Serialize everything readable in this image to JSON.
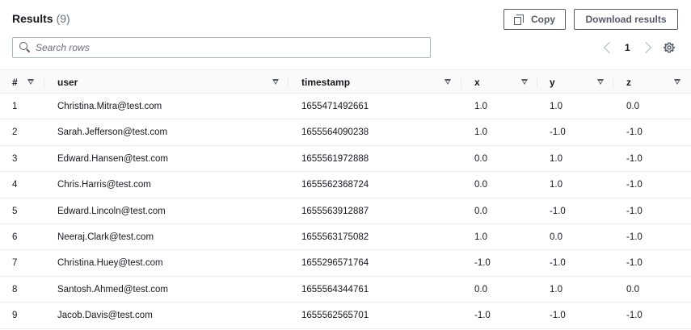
{
  "header": {
    "title": "Results",
    "count": "(9)"
  },
  "buttons": {
    "copy": "Copy",
    "download": "Download results"
  },
  "search": {
    "placeholder": "Search rows"
  },
  "pagination": {
    "current_page": "1"
  },
  "table": {
    "columns": [
      "#",
      "user",
      "timestamp",
      "x",
      "y",
      "z"
    ],
    "rows": [
      [
        "1",
        "Christina.Mitra@test.com",
        "1655471492661",
        "1.0",
        "1.0",
        "0.0"
      ],
      [
        "2",
        "Sarah.Jefferson@test.com",
        "1655564090238",
        "1.0",
        "-1.0",
        "-1.0"
      ],
      [
        "3",
        "Edward.Hansen@test.com",
        "1655561972888",
        "0.0",
        "1.0",
        "-1.0"
      ],
      [
        "4",
        "Chris.Harris@test.com",
        "1655562368724",
        "0.0",
        "1.0",
        "-1.0"
      ],
      [
        "5",
        "Edward.Lincoln@test.com",
        "1655563912887",
        "0.0",
        "-1.0",
        "-1.0"
      ],
      [
        "6",
        "Neeraj.Clark@test.com",
        "1655563175082",
        "1.0",
        "0.0",
        "-1.0"
      ],
      [
        "7",
        "Christina.Huey@test.com",
        "1655296571764",
        "-1.0",
        "-1.0",
        "-1.0"
      ],
      [
        "8",
        "Santosh.Ahmed@test.com",
        "1655564344761",
        "0.0",
        "1.0",
        "0.0"
      ],
      [
        "9",
        "Jacob.Davis@test.com",
        "1655562565701",
        "-1.0",
        "-1.0",
        "-1.0"
      ]
    ]
  },
  "colors": {
    "text": "#16191f",
    "muted": "#687078",
    "border": "#eaeded",
    "button_border": "#545b64"
  }
}
